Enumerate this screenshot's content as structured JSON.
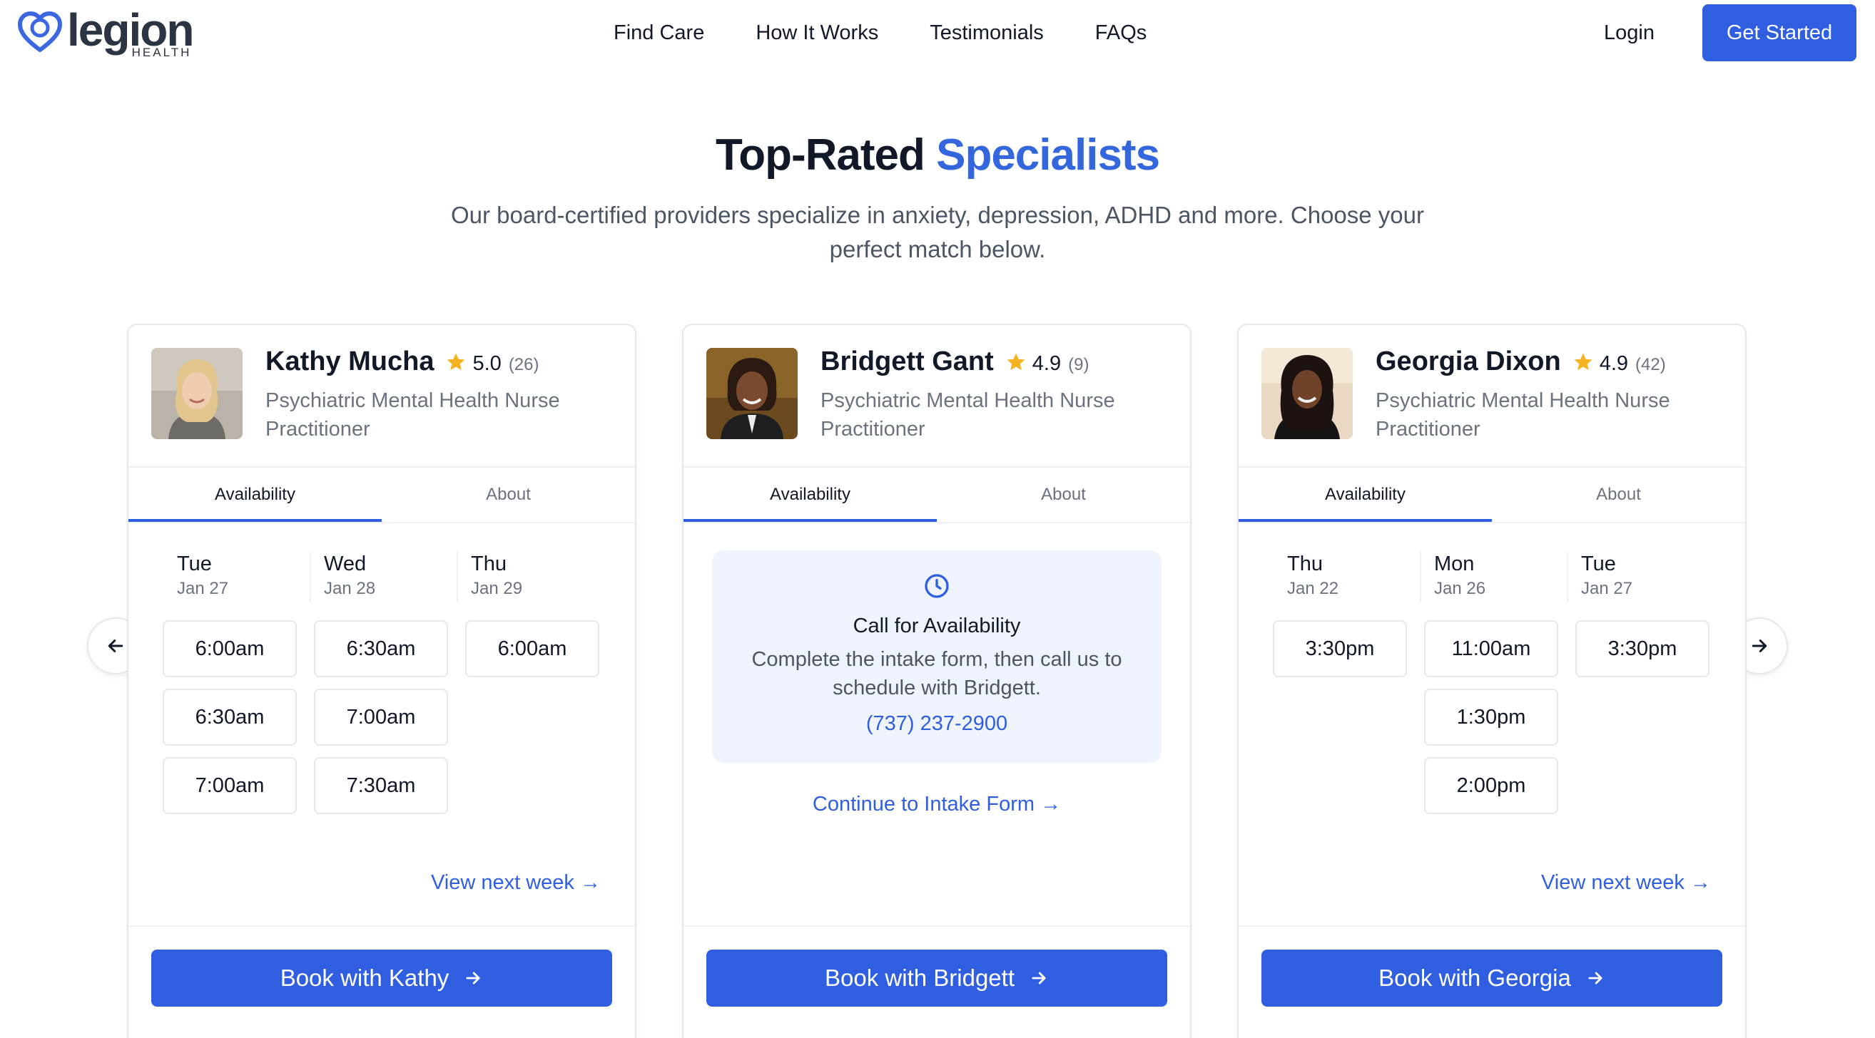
{
  "header": {
    "logo_word": "legion",
    "logo_sub": "HEALTH",
    "nav": [
      "Find Care",
      "How It Works",
      "Testimonials",
      "FAQs"
    ],
    "login_label": "Login",
    "cta_label": "Get Started"
  },
  "hero": {
    "title_main": "Top-Rated",
    "title_accent": "Specialists",
    "subtitle": "Our board-certified providers specialize in anxiety, depression, ADHD and more. Choose your perfect match below."
  },
  "carousel": {
    "prev_icon": "arrow-left-icon",
    "next_icon": "arrow-right-icon"
  },
  "specialists": [
    {
      "name": "Kathy Mucha",
      "rating": "5.0",
      "reviews": "(26)",
      "role": "Psychiatric Mental Health Nurse Practitioner",
      "tabs": [
        "Availability",
        "About"
      ],
      "active_tab": "Availability",
      "days": [
        {
          "day": "Tue",
          "date": "Jan 27",
          "slots": [
            "6:00am",
            "6:30am",
            "7:00am"
          ]
        },
        {
          "day": "Wed",
          "date": "Jan 28",
          "slots": [
            "6:30am",
            "7:00am",
            "7:30am"
          ]
        },
        {
          "day": "Thu",
          "date": "Jan 29",
          "slots": [
            "6:00am"
          ]
        }
      ],
      "next_week": "View next week →",
      "book_label": "Book with Kathy"
    },
    {
      "name": "Bridgett Gant",
      "rating": "4.9",
      "reviews": "(9)",
      "role": "Psychiatric Mental Health Nurse Practitioner",
      "tabs": [
        "Availability",
        "About"
      ],
      "active_tab": "Availability",
      "call": {
        "title": "Call for Availability",
        "desc": "Complete the intake form, then call us to schedule with Bridgett.",
        "phone": "(737) 237-2900",
        "icon": "clock-icon"
      },
      "continue_label": "Continue to Intake Form →",
      "book_label": "Book with Bridgett"
    },
    {
      "name": "Georgia Dixon",
      "rating": "4.9",
      "reviews": "(42)",
      "role": "Psychiatric Mental Health Nurse Practitioner",
      "tabs": [
        "Availability",
        "About"
      ],
      "active_tab": "Availability",
      "days": [
        {
          "day": "Thu",
          "date": "Jan 22",
          "slots": [
            "3:30pm"
          ]
        },
        {
          "day": "Mon",
          "date": "Jan 26",
          "slots": [
            "11:00am",
            "1:30pm",
            "2:00pm"
          ]
        },
        {
          "day": "Tue",
          "date": "Jan 27",
          "slots": [
            "3:30pm"
          ]
        }
      ],
      "next_week": "View next week →",
      "book_label": "Book with Georgia"
    }
  ],
  "colors": {
    "accent": "#2f5fe0",
    "star": "#f5b321",
    "call_bg": "#eff4fc"
  }
}
